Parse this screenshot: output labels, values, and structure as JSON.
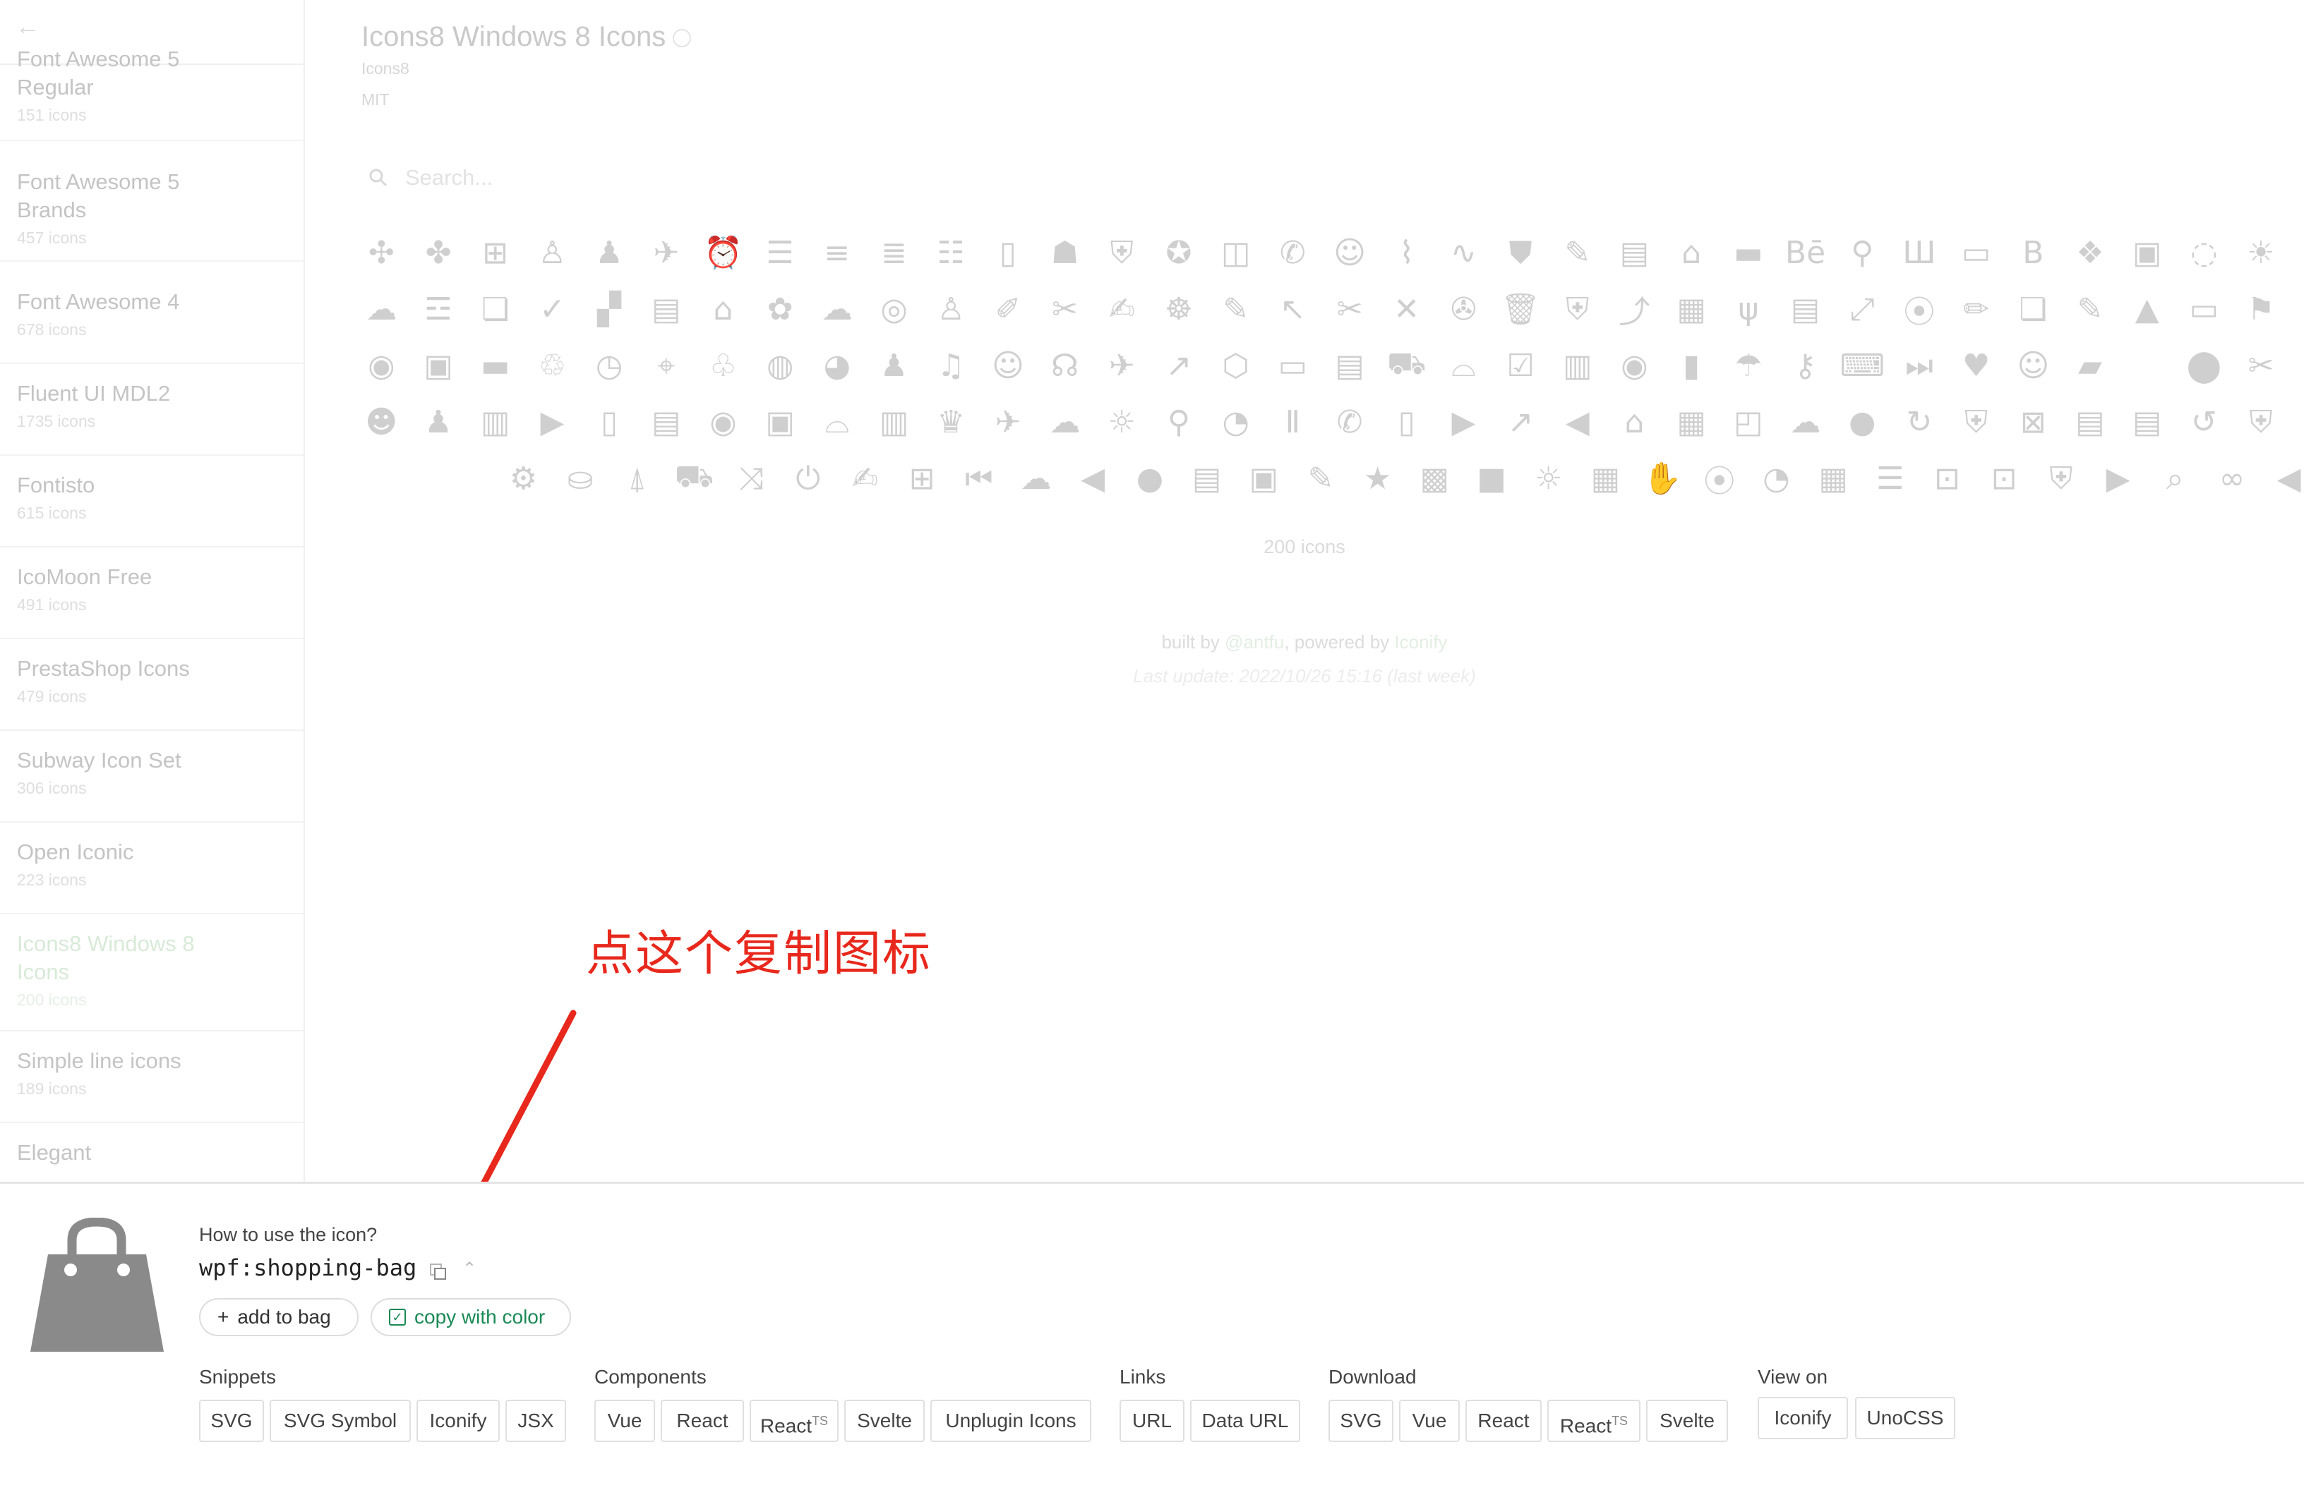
{
  "sidebar": {
    "sets": [
      {
        "name": "Font Awesome 5 Regular",
        "count": "151 icons"
      },
      {
        "name": "Font Awesome 5 Brands",
        "count": "457 icons"
      },
      {
        "name": "Font Awesome 4",
        "count": "678 icons"
      },
      {
        "name": "Fluent UI MDL2",
        "count": "1735 icons"
      },
      {
        "name": "Fontisto",
        "count": "615 icons"
      },
      {
        "name": "IcoMoon Free",
        "count": "491 icons"
      },
      {
        "name": "PrestaShop Icons",
        "count": "479 icons"
      },
      {
        "name": "Subway Icon Set",
        "count": "306 icons"
      },
      {
        "name": "Open Iconic",
        "count": "223 icons"
      },
      {
        "name": "Icons8 Windows 8 Icons",
        "count": "200 icons"
      },
      {
        "name": "Simple line icons",
        "count": "189 icons"
      },
      {
        "name": "Elegant",
        "count": ""
      }
    ],
    "active_index": 9
  },
  "header": {
    "title": "Icons8 Windows 8 Icons",
    "author": "Icons8",
    "license": "MIT"
  },
  "search": {
    "placeholder": "Search..."
  },
  "grid": {
    "rows": [
      [
        "✣",
        "✤",
        "⊞",
        "♙",
        "♟",
        "✈",
        "⏰",
        "☰",
        "≡",
        "≣",
        "☷",
        "▯",
        "☗",
        "⛨",
        "✪",
        "◫",
        "✆",
        "☺",
        "⌇",
        "∿",
        "⛊",
        "✎",
        "▤",
        "⌂",
        "▬",
        "Bē",
        "⚲",
        "Ш",
        "▭",
        "B",
        "❖",
        "▣",
        "◌",
        "☀",
        "▦"
      ],
      [
        "☁",
        "☲",
        "❏",
        "✓",
        "▞",
        "▤",
        "⌂",
        "✿",
        "☁",
        "◎",
        "♙",
        "✐",
        "✂",
        "✍",
        "☸",
        "✎",
        "↖",
        "✂",
        "✕",
        "✇",
        "🗑",
        "⛨",
        "⤴",
        "▦",
        "ψ",
        "▤",
        "⤢",
        "⦿",
        "✏",
        "❏",
        "✎",
        "▲",
        "▭",
        "⚑",
        "▶"
      ],
      [
        "◉",
        "▣",
        "▬",
        "♲",
        "◷",
        "⌖",
        "♧",
        "◍",
        "◕",
        "♟",
        "♫",
        "☺",
        "☊",
        "✈",
        "↗",
        "⬡",
        "▭",
        "▤",
        "⛟",
        "⌓",
        "☑",
        "▥",
        "◉",
        "▮",
        "☂",
        "⚷",
        "⌨",
        "⏭",
        "♥",
        "☺",
        "▰",
        "",
        "⬤",
        "✂",
        "▦"
      ],
      [
        "☻",
        "♟",
        "▥",
        "▶",
        "▯",
        "▤",
        "◉",
        "▣",
        "⌓",
        "▥",
        "♛",
        "✈",
        "☁",
        "☼",
        "⚲",
        "◔",
        "Ⅱ",
        "✆",
        "▯",
        "▶",
        "↗",
        "◀",
        "⌂",
        "▦",
        "◰",
        "☁",
        "●",
        "↻",
        "⛨",
        "⊠",
        "▤",
        "▤",
        "↺",
        "⛨",
        "▢"
      ],
      [
        "⚙",
        "⛀",
        "⍋",
        "⛟",
        "⤨",
        "⏻",
        "✍",
        "⊞",
        "⏮",
        "☁",
        "◀",
        "●",
        "▤",
        "▣",
        "✎",
        "★",
        "▩",
        "■",
        "☼",
        "▦",
        "✋",
        "⦿",
        "◔",
        "▦",
        "☰",
        "⊡",
        "⊡",
        "⛨",
        "▶",
        "⌕",
        "∞",
        "◀"
      ]
    ],
    "count": "200 icons"
  },
  "footer": {
    "built_by_prefix": "built by ",
    "author_handle": "@antfu",
    "powered_prefix": ", powered by ",
    "powered_name": "Iconify",
    "last_update": "Last update: 2022/10/26 15:16 (last week)"
  },
  "annotation": {
    "text": "点这个复制图标"
  },
  "panel": {
    "how_label": "How to use the icon?",
    "icon_id": "wpf:shopping-bag",
    "add_to_bag": "add to bag",
    "copy_with_color": "copy with color",
    "groups": [
      {
        "label": "Snippets",
        "buttons": [
          "SVG",
          "SVG Symbol",
          "Iconify",
          "JSX"
        ]
      },
      {
        "label": "Components",
        "buttons": [
          "Vue",
          "React",
          "React",
          "Svelte",
          "Unplugin Icons"
        ]
      },
      {
        "label": "Links",
        "buttons": [
          "URL",
          "Data URL"
        ]
      },
      {
        "label": "Download",
        "buttons": [
          "SVG",
          "Vue",
          "React",
          "React",
          "Svelte"
        ]
      },
      {
        "label": "View on",
        "buttons": [
          "Iconify",
          "UnoCSS"
        ]
      }
    ],
    "ts_badge": "TS"
  },
  "colors": {
    "accent": "#1a8a55",
    "annotation": "#e8281c",
    "bag": "#8a8a8a"
  }
}
